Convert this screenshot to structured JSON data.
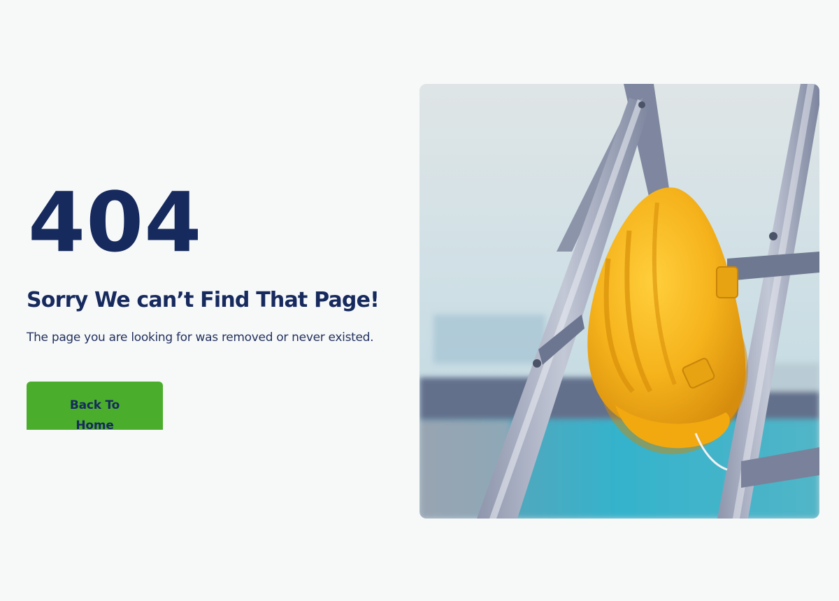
{
  "error": {
    "code": "404",
    "headline": "Sorry We can’t Find That Page!",
    "description": "The page you are looking for was removed or never existed."
  },
  "actions": {
    "back_home_label": "Back To Home"
  },
  "colors": {
    "page_background": "#f7f9f9",
    "heading_navy": "#172a5e",
    "button_green": "#4aae2c",
    "helmet_yellow": "#f5b21b"
  },
  "image": {
    "subject": "yellow-hard-hat-on-ladder"
  }
}
